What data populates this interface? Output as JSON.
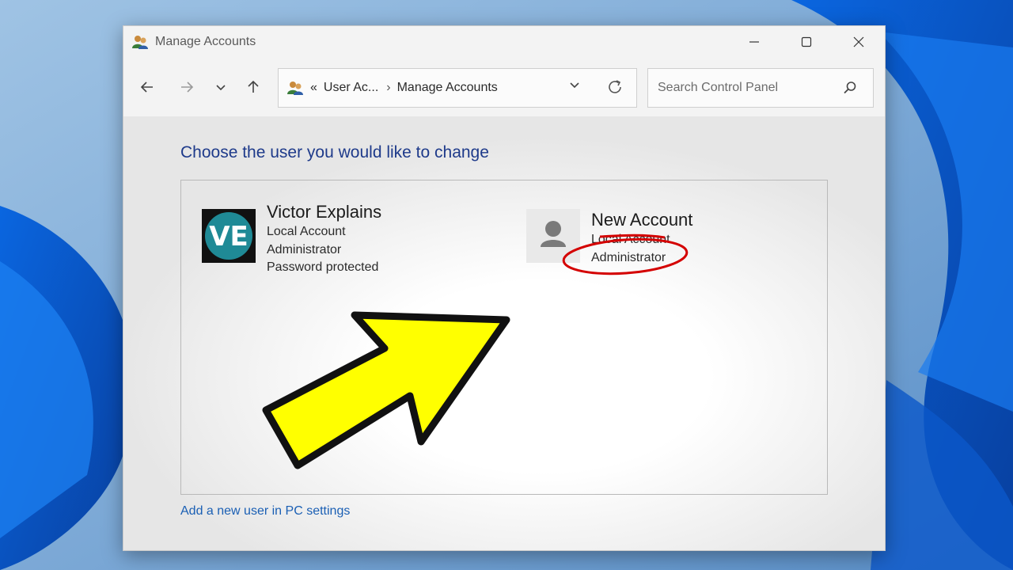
{
  "window": {
    "title": "Manage Accounts",
    "controls": {
      "minimize_icon": "minimize-icon",
      "maximize_icon": "maximize-icon",
      "close_icon": "close-icon"
    }
  },
  "navigation": {
    "back_icon": "back-arrow-icon",
    "forward_icon": "forward-arrow-icon",
    "recent_icon": "chevron-down-icon",
    "up_icon": "up-arrow-icon"
  },
  "address_bar": {
    "overflow": "«",
    "breadcrumbs": [
      "User Ac...",
      "Manage Accounts"
    ],
    "separator": "›"
  },
  "search": {
    "placeholder": "Search Control Panel"
  },
  "main": {
    "heading": "Choose the user you would like to change",
    "accounts": [
      {
        "name": "Victor Explains",
        "type": "Local Account",
        "role": "Administrator",
        "status": "Password protected",
        "avatar_text": "VE"
      },
      {
        "name": "New Account",
        "type": "Local Account",
        "role": "Administrator"
      }
    ],
    "add_user_link": "Add a new user in PC settings"
  },
  "colors": {
    "heading": "#1e3a8a",
    "link": "#1a5fb4",
    "annotation_arrow": "#ffff00",
    "annotation_circle": "#d40000",
    "avatar_ve_teal": "#1f8a96"
  }
}
